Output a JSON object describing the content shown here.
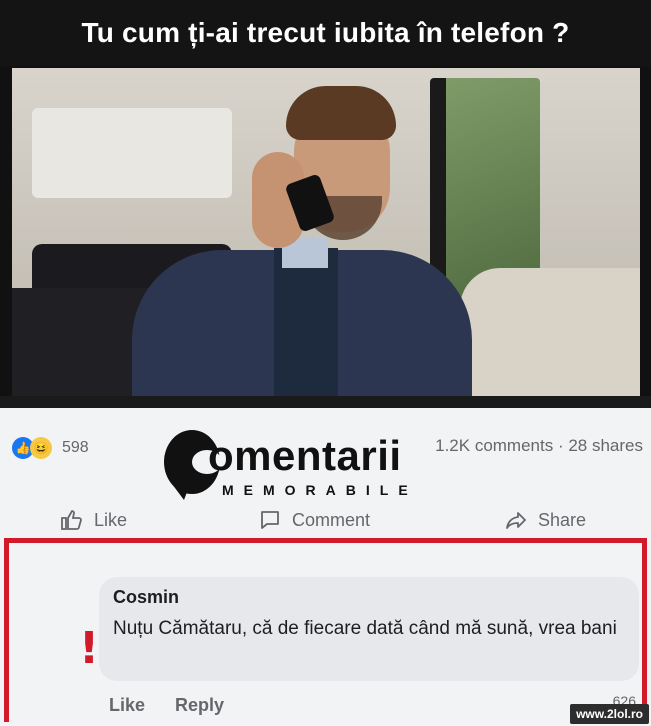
{
  "meme": {
    "title": "Tu cum ți-ai trecut  iubita în telefon ?"
  },
  "post": {
    "reaction_count": "598",
    "share_stats": "1.2K comments · 28 shares",
    "actions": {
      "like": "Like",
      "comment": "Comment",
      "share": "Share"
    }
  },
  "logo": {
    "word": "omentarii",
    "subtitle": "MEMORABILE"
  },
  "comment": {
    "author": "Cosmin",
    "text": "Nuțu Cămătaru, că de fiecare dată când mă sună, vrea bani",
    "like": "Like",
    "reply": "Reply",
    "reaction_count": "626"
  },
  "watermark": "www.2lol.ro",
  "colors": {
    "accent_red": "#d11a2a",
    "facebook_blue": "#1877f2",
    "muted_text": "#65676b"
  }
}
